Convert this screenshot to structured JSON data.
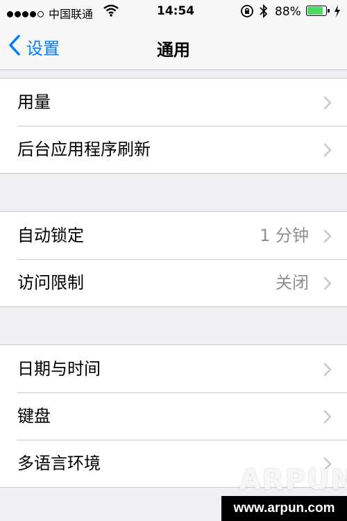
{
  "status_bar": {
    "signal_bars": [
      true,
      true,
      true,
      true,
      false
    ],
    "carrier": "中国联通",
    "time": "14:54",
    "battery_percent": "88%",
    "battery_level": 0.88,
    "battery_color": "#4cd964",
    "icons": [
      "wifi-icon",
      "rotation-lock-icon",
      "bluetooth-icon",
      "battery-icon",
      "charging-icon"
    ]
  },
  "nav": {
    "back_label": "设置",
    "title": "通用",
    "accent": "#007aff"
  },
  "groups": [
    {
      "items": [
        {
          "label": "用量",
          "value": ""
        },
        {
          "label": "后台应用程序刷新",
          "value": ""
        }
      ]
    },
    {
      "items": [
        {
          "label": "自动锁定",
          "value": "1 分钟"
        },
        {
          "label": "访问限制",
          "value": "关闭"
        }
      ]
    },
    {
      "items": [
        {
          "label": "日期与时间",
          "value": ""
        },
        {
          "label": "键盘",
          "value": ""
        },
        {
          "label": "多语言环境",
          "value": ""
        }
      ]
    }
  ],
  "watermark": {
    "logo": "ARPUN",
    "url": "www.arpun.com"
  }
}
